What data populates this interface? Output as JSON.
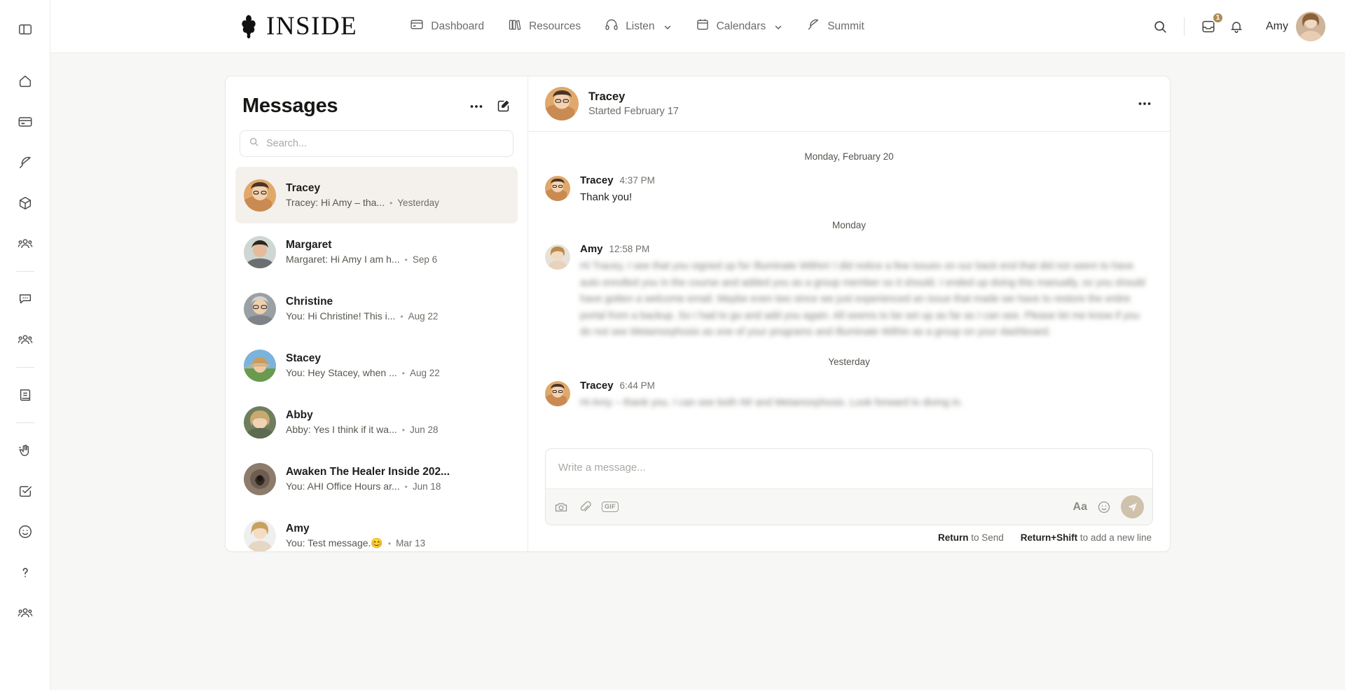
{
  "colors": {
    "accent": "#b08a57",
    "send": "#cfc1ab",
    "active_row": "#f4f1ec"
  },
  "rail": {
    "items": [
      {
        "name": "panel-toggle-icon",
        "label": "Toggle panel"
      },
      {
        "name": "home-icon",
        "label": "Home"
      },
      {
        "name": "card-icon",
        "label": "Cards"
      },
      {
        "name": "feather-icon",
        "label": "Summit"
      },
      {
        "name": "box-icon",
        "label": "Resources"
      },
      {
        "name": "group-icon",
        "label": "Groups"
      },
      {
        "name": "chat-icon",
        "label": "Messages"
      },
      {
        "name": "community-icon",
        "label": "Community"
      },
      {
        "name": "book-icon",
        "label": "Library"
      },
      {
        "name": "wave-icon",
        "label": "Welcome"
      },
      {
        "name": "checkbox-icon",
        "label": "Tasks"
      },
      {
        "name": "smiley-icon",
        "label": "Feedback"
      },
      {
        "name": "help-icon",
        "label": "Help"
      },
      {
        "name": "members-icon",
        "label": "Members"
      }
    ]
  },
  "header": {
    "brand": "INSIDE",
    "nav": [
      {
        "label": "Dashboard",
        "icon": "dashboard-icon",
        "caret": false
      },
      {
        "label": "Resources",
        "icon": "books-icon",
        "caret": false
      },
      {
        "label": "Listen",
        "icon": "headphones-icon",
        "caret": true
      },
      {
        "label": "Calendars",
        "icon": "calendar-icon",
        "caret": true
      },
      {
        "label": "Summit",
        "icon": "feather-icon",
        "caret": false
      }
    ],
    "search_icon": "search-icon",
    "inbox_icon": "inbox-icon",
    "inbox_badge": "1",
    "bell_icon": "bell-icon",
    "user_name": "Amy"
  },
  "messages_panel": {
    "title": "Messages",
    "more_icon": "ellipsis-icon",
    "compose_icon": "compose-icon",
    "search_placeholder": "Search...",
    "search_value": "",
    "conversations": [
      {
        "name": "Tracey",
        "preview": "Tracey: Hi Amy – tha...",
        "time": "Yesterday",
        "active": true
      },
      {
        "name": "Margaret",
        "preview": "Margaret: Hi Amy I am h...",
        "time": "Sep 6",
        "active": false
      },
      {
        "name": "Christine",
        "preview": "You: Hi Christine! This i...",
        "time": "Aug 22",
        "active": false
      },
      {
        "name": "Stacey",
        "preview": "You: Hey Stacey, when ...",
        "time": "Aug 22",
        "active": false
      },
      {
        "name": "Abby",
        "preview": "Abby: Yes I think if it wa...",
        "time": "Jun 28",
        "active": false
      },
      {
        "name": "Awaken The Healer Inside 202...",
        "preview": "You: AHI Office Hours ar...",
        "time": "Jun 18",
        "active": false
      },
      {
        "name": "Amy",
        "preview": "You: Test message.😊",
        "time": "Mar 13",
        "active": false
      }
    ]
  },
  "thread": {
    "title": "Tracey",
    "subtitle": "Started February 17",
    "more_icon": "ellipsis-icon",
    "groups": [
      {
        "separator": "Monday, February 20",
        "messages": [
          {
            "author": "Tracey",
            "time": "4:37 PM",
            "text": "Thank you!",
            "redacted": false
          }
        ]
      },
      {
        "separator": "Monday",
        "messages": [
          {
            "author": "Amy",
            "time": "12:58 PM",
            "text": "Hi Tracey, I see that you signed up for Illuminate Within! I did notice a few issues on our back end that did not seem to have auto enrolled you in the course and added you as a group member so it should. I ended up doing this manually, so you should have gotten a welcome email. Maybe even two since we just experienced an issue that made we have to restore the entire portal from a backup. So I had to go and add you again. All seems to be set up as far as I can see. Please let me know if you do not see Metamorphosis as one of your programs and Illuminate Within as a group on your dashboard.",
            "redacted": true
          }
        ]
      },
      {
        "separator": "Yesterday",
        "messages": [
          {
            "author": "Tracey",
            "time": "6:44 PM",
            "text": "Hi Amy – thank you. I can see both IW and Metamorphosis. Look forward to diving in.",
            "redacted": true
          }
        ]
      }
    ]
  },
  "composer": {
    "placeholder": "Write a message...",
    "value": "",
    "camera_icon": "camera-icon",
    "attach_icon": "paperclip-icon",
    "gif_icon": "gif-icon",
    "format_label": "Aa",
    "emoji_icon": "emoji-icon",
    "send_icon": "send-icon",
    "hint_send_key": "Return",
    "hint_send_text": "to Send",
    "hint_newline_key": "Return+Shift",
    "hint_newline_text": "to add a new line"
  }
}
